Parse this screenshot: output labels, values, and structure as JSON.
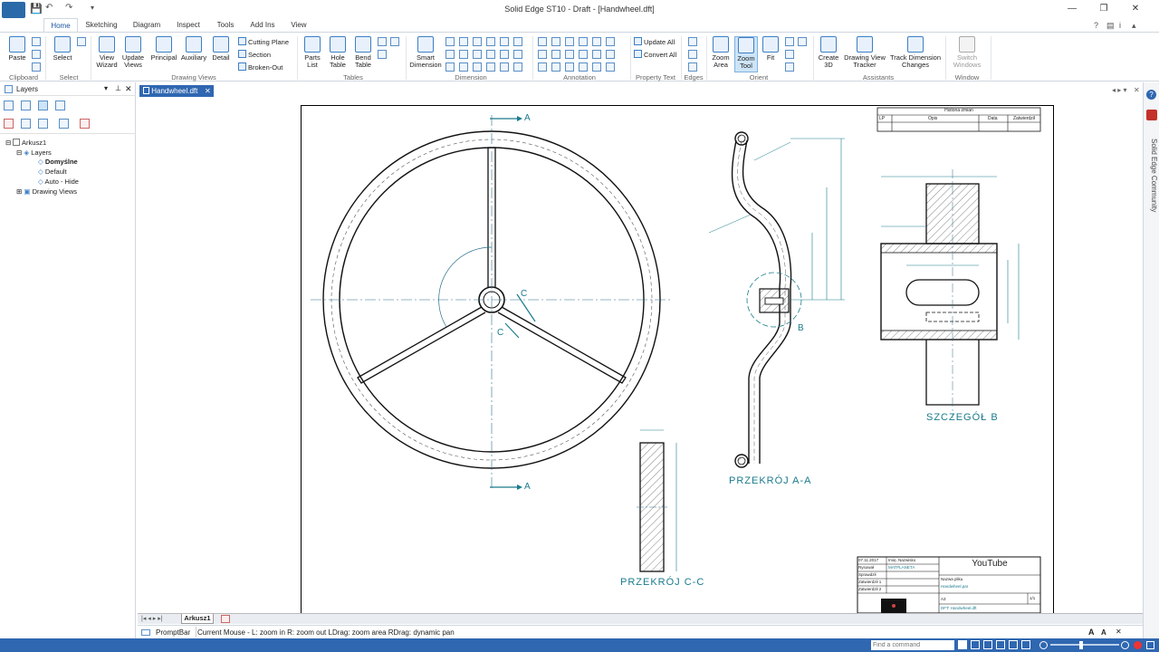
{
  "window": {
    "title": "Solid Edge ST10 - Draft - [Handwheel.dft]"
  },
  "quick_access_more": "▾",
  "tabs": [
    "Home",
    "Sketching",
    "Diagram",
    "Inspect",
    "Tools",
    "Add Ins",
    "View"
  ],
  "ribbon": {
    "clipboard": {
      "paste": "Paste",
      "group": "Clipboard"
    },
    "select": {
      "select": "Select",
      "group": "Select"
    },
    "drawing_views": {
      "view_wizard_1": "View",
      "view_wizard_2": "Wizard",
      "update_views_1": "Update",
      "update_views_2": "Views",
      "principal": "Principal",
      "auxiliary": "Auxiliary",
      "detail": "Detail",
      "cutting_plane": "Cutting Plane",
      "section": "Section",
      "broken_out": "Broken-Out",
      "group": "Drawing Views"
    },
    "tables": {
      "parts_list_1": "Parts",
      "parts_list_2": "List",
      "hole_table_1": "Hole",
      "hole_table_2": "Table",
      "bend_table_1": "Bend",
      "bend_table_2": "Table",
      "group": "Tables"
    },
    "dimension": {
      "smart_1": "Smart",
      "smart_2": "Dimension",
      "group": "Dimension"
    },
    "annotation": {
      "group": "Annotation"
    },
    "property_text": {
      "update_all": "Update All",
      "convert_all": "Convert All",
      "group": "Property Text"
    },
    "edges": {
      "group": "Edges"
    },
    "orient": {
      "zoom_area_1": "Zoom",
      "zoom_area_2": "Area",
      "zoom_tool_1": "Zoom",
      "zoom_tool_2": "Tool",
      "fit": "Fit",
      "group": "Orient"
    },
    "assistants": {
      "create3d_1": "Create",
      "create3d_2": "3D",
      "dvt_1": "Drawing View",
      "dvt_2": "Tracker",
      "tdc_1": "Track Dimension",
      "tdc_2": "Changes",
      "group": "Assistants"
    },
    "window": {
      "switch_1": "Switch",
      "switch_2": "Windows",
      "group": "Window"
    }
  },
  "layers_panel": {
    "title": "Layers",
    "tree": {
      "root": "Arkusz1",
      "layers": "Layers",
      "active": "Domyślne",
      "default": "Default",
      "autohide": "Auto - Hide",
      "drawing_views": "Drawing Views"
    }
  },
  "document_tab": "Handwheel.dft",
  "drawing": {
    "section_letters": {
      "a_top": "A",
      "a_bottom": "A",
      "c1": "C",
      "c2": "C",
      "b": "B"
    },
    "view_labels": {
      "section_aa": "PRZEKRÓJ A-A",
      "section_cc": "PRZEKRÓJ C-C",
      "detail_b": "SZCZEGÓŁ B"
    },
    "revision_table": {
      "title": "Historia zmian",
      "cols": [
        "LP",
        "Opis",
        "Data",
        "Zatwierdził"
      ]
    },
    "title_block": {
      "company": "YouTube",
      "rows": [
        [
          "07.11.2017",
          "Imię, Nazwisko"
        ],
        [
          "Rysował",
          "MATPLANETA"
        ],
        [
          "Sprawdził",
          ""
        ],
        [
          "Zatwierdził 1",
          ""
        ],
        [
          "Zatwierdził 2",
          ""
        ]
      ],
      "name_label": "Nazwa pliku",
      "name_value": "Handwheel.par",
      "dft": "DFT: Handwheel.dft",
      "sheet_no": "1/1",
      "format": "A3"
    }
  },
  "right_strip": {
    "label": "Solid Edge Community"
  },
  "sheet_tab": "Arkusz1",
  "prompt": {
    "label": "PromptBar",
    "text": "Current Mouse - L: zoom in  R: zoom out  LDrag: zoom area  RDrag: dynamic pan"
  },
  "status": {
    "command_placeholder": "Find a command"
  },
  "colors": {
    "accent": "#1a55a0",
    "statusbar": "#2f67b1",
    "centerline": "#2a6f8a",
    "dimension": "#1a7b8c"
  }
}
